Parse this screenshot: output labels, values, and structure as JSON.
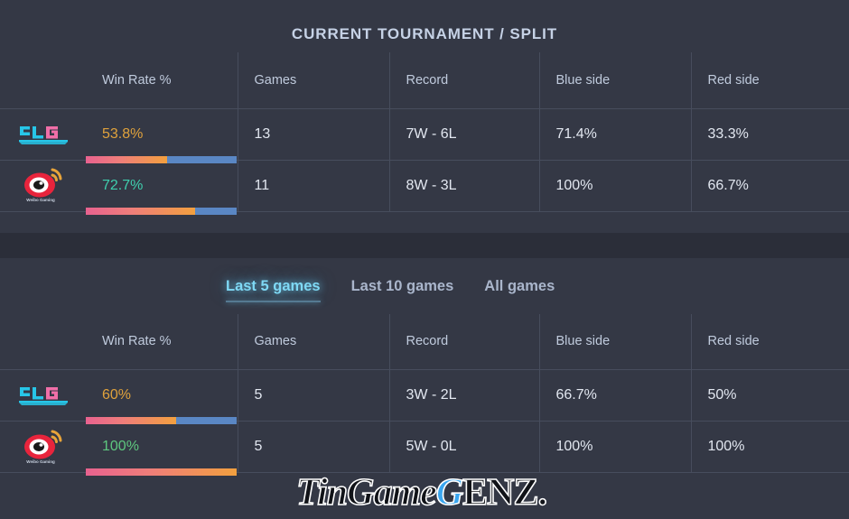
{
  "theme": {
    "background": "#343845",
    "band": "#2b2e39",
    "border": "#474d5d",
    "title_color": "#c6d2e6",
    "bar_blue": "#5a87c4",
    "bar_gradient_start": "#e8628f",
    "bar_gradient_end": "#f2a03f",
    "accent_cyan": "#7fd9f5"
  },
  "top_section": {
    "title": "CURRENT TOURNAMENT / SPLIT",
    "headers": [
      "",
      "Win Rate %",
      "Games",
      "Record",
      "Blue side",
      "Red side"
    ],
    "rows": [
      {
        "team": "BLG",
        "team_full": "Bilibili Gaming",
        "logo": "blg-logo",
        "win_rate": "53.8%",
        "win_rate_value": 53.8,
        "win_rate_color": "orange",
        "games": "13",
        "record": "7W - 6L",
        "blue_side": "71.4%",
        "blue_side_color": "teal",
        "red_side": "33.3%",
        "red_side_color": "red"
      },
      {
        "team": "WBG",
        "team_full": "Weibo Gaming",
        "logo": "weibo-gaming-logo",
        "win_rate": "72.7%",
        "win_rate_value": 72.7,
        "win_rate_color": "teal",
        "games": "11",
        "record": "8W - 3L",
        "blue_side": "100%",
        "blue_side_color": "green",
        "red_side": "66.7%",
        "red_side_color": "orange"
      }
    ]
  },
  "bottom_section": {
    "tabs": [
      {
        "label": "Last 5 games",
        "active": true
      },
      {
        "label": "Last 10 games",
        "active": false
      },
      {
        "label": "All games",
        "active": false
      }
    ],
    "headers": [
      "",
      "Win Rate %",
      "Games",
      "Record",
      "Blue side",
      "Red side"
    ],
    "rows": [
      {
        "team": "BLG",
        "team_full": "Bilibili Gaming",
        "logo": "blg-logo",
        "win_rate": "60%",
        "win_rate_value": 60,
        "win_rate_color": "orange",
        "games": "5",
        "record": "3W - 2L",
        "blue_side": "66.7%",
        "blue_side_color": "orange",
        "red_side": "50%",
        "red_side_color": "orange"
      },
      {
        "team": "WBG",
        "team_full": "Weibo Gaming",
        "logo": "weibo-gaming-logo",
        "win_rate": "100%",
        "win_rate_value": 100,
        "win_rate_color": "green",
        "games": "5",
        "record": "5W - 0L",
        "blue_side": "100%",
        "blue_side_color": "green",
        "red_side": "100%",
        "red_side_color": "green"
      }
    ]
  },
  "watermark": {
    "part1": "TinGame",
    "part2": "G",
    "part3": "ENZ."
  }
}
